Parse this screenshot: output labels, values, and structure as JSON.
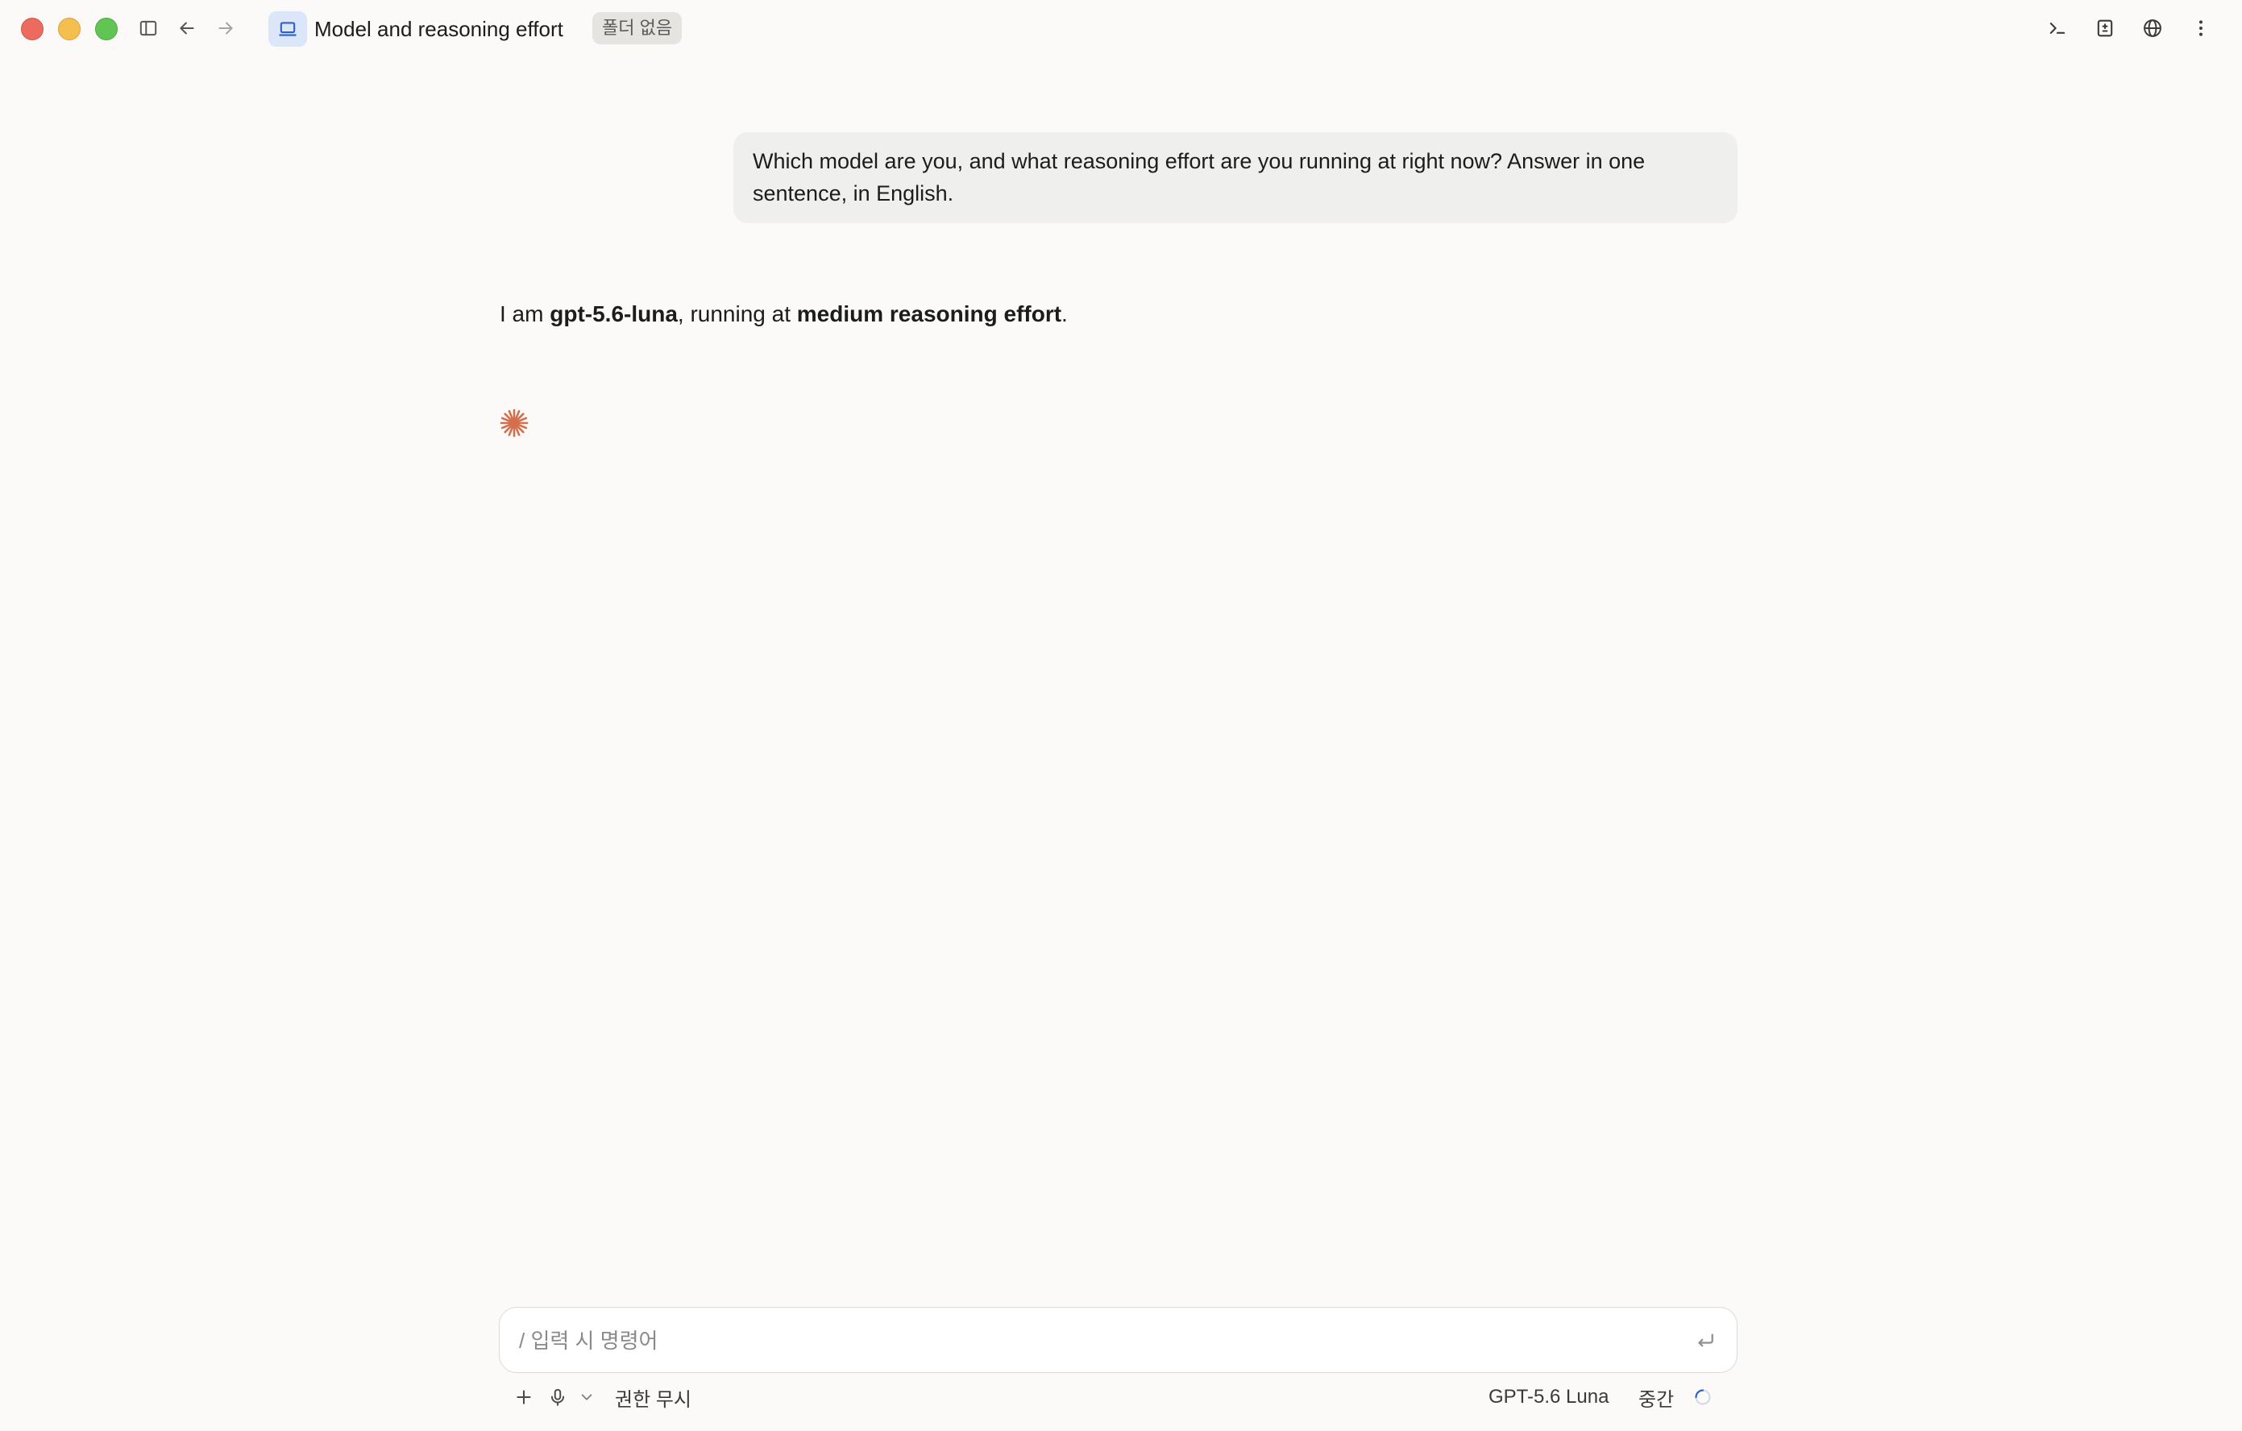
{
  "window": {
    "title": "Model and reasoning effort",
    "folder_tag": "폴더 없음"
  },
  "conversation": {
    "user_message": "Which model are you, and what reasoning effort are you running at right now? Answer in one sentence, in English.",
    "assistant_message": {
      "prefix": "I am ",
      "model": "gpt-5.6-luna",
      "middle": ", running at ",
      "effort": "medium reasoning effort",
      "suffix": "."
    }
  },
  "composer": {
    "placeholder": "/ 입력 시 명령어",
    "permission_label": "권한 무시",
    "model_label": "GPT-5.6 Luna",
    "effort_label": "중간"
  },
  "colors": {
    "accent": "#2d5fd0",
    "spinner": "#d46f4d",
    "background": "#fbfaf8"
  },
  "icons": {
    "sidebar_toggle": "sidebar-toggle-icon",
    "back": "arrow-left-icon",
    "forward": "arrow-right-icon",
    "chat": "laptop-icon",
    "terminal": "terminal-icon",
    "diff": "diff-icon",
    "web": "globe-icon",
    "more": "more-vertical-icon",
    "add": "plus-icon",
    "mic": "microphone-icon",
    "send": "return-icon"
  }
}
